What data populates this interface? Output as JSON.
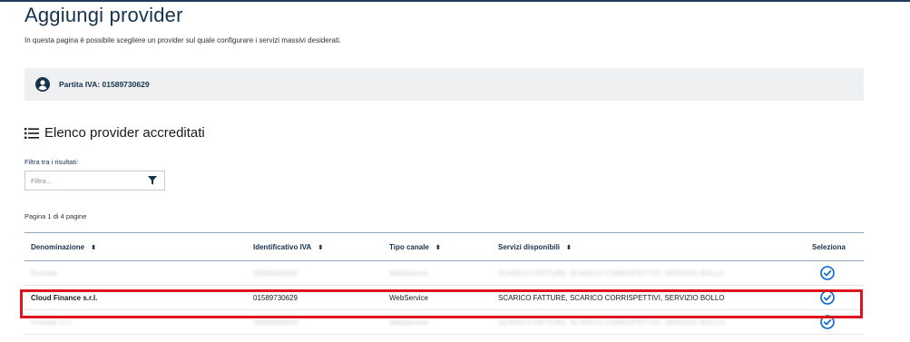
{
  "page": {
    "title": "Aggiungi provider",
    "description": "In questa pagina è possibile scegliere un provider sul quale configurare i servizi massivi desiderati."
  },
  "partita_iva": {
    "label": "Partita IVA: 01589730629",
    "icon": "user-circle-icon"
  },
  "section": {
    "title": "Elenco provider accreditati",
    "icon": "list-icon"
  },
  "filter": {
    "label": "Filtra tra i risultati:",
    "placeholder": "Filtra...",
    "icon": "funnel-icon"
  },
  "pagination": {
    "text": "Pagina 1 di 4 pagine"
  },
  "table": {
    "headers": {
      "name": "Denominazione",
      "vat": "Identificativo IVA",
      "channel": "Tipo canale",
      "services": "Servizi disponibili",
      "select": "Seleziona"
    },
    "sort_glyph": "⬍",
    "rows": [
      {
        "name": "Provider",
        "vat": "00000000000",
        "channel": "WebService",
        "services": "SCARICO FATTURE, SCARICO CORRISPETTIVI, SERVIZIO BOLLO"
      },
      {
        "name": "Cloud Finance s.r.l.",
        "vat": "01589730629",
        "channel": "WebService",
        "services": "SCARICO FATTURE, SCARICO CORRISPETTIVI, SERVIZIO BOLLO"
      },
      {
        "name": "Provider s.r.l.",
        "vat": "00000000000",
        "channel": "WebService",
        "services": "SCARICO FATTURE, SCARICO CORRISPETTIVI, SERVIZIO BOLLO"
      }
    ]
  },
  "colors": {
    "primary": "#0066cc",
    "title": "#17324d",
    "highlight": "#e0141e",
    "panel": "#eef0f2"
  }
}
